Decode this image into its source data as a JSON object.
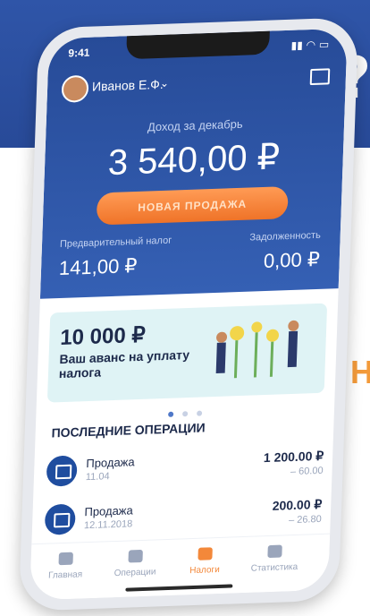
{
  "background": {
    "banner_glyph": "?",
    "side_glyph": "Н:"
  },
  "status_bar": {
    "time": "9:41",
    "icons": "signal-wifi-battery"
  },
  "header": {
    "user_name": "Иванов Е.Ф.",
    "chevron": "⌄"
  },
  "income": {
    "label": "Доход за декабрь",
    "value": "3 540,00 ₽"
  },
  "new_sale_button": "НОВАЯ ПРОДАЖА",
  "summary": {
    "tax_label": "Предварительный налог",
    "tax_value": "141,00 ₽",
    "debt_label": "Задолженность",
    "debt_value": "0,00 ₽"
  },
  "promo": {
    "amount": "10 000 ₽",
    "text": "Ваш аванс на уплату налога"
  },
  "carousel": {
    "count": 3,
    "active": 0
  },
  "operations": {
    "title": "ПОСЛЕДНИЕ ОПЕРАЦИИ",
    "items": [
      {
        "name": "Продажа",
        "date": "11.04",
        "amount": "1 200.00 ₽",
        "tax": "– 60.00"
      },
      {
        "name": "Продажа",
        "date": "12.11.2018",
        "amount": "200.00 ₽",
        "tax": "– 26.80"
      }
    ]
  },
  "tabbar": [
    {
      "label": "Главная",
      "icon": "briefcase-icon"
    },
    {
      "label": "Операции",
      "icon": "receipt-icon"
    },
    {
      "label": "Налоги",
      "icon": "tax-icon",
      "active": true
    },
    {
      "label": "Статистика",
      "icon": "chart-icon"
    }
  ],
  "colors": {
    "primary": "#274b98",
    "accent": "#f3883a",
    "promo_bg": "#dff3f5"
  }
}
